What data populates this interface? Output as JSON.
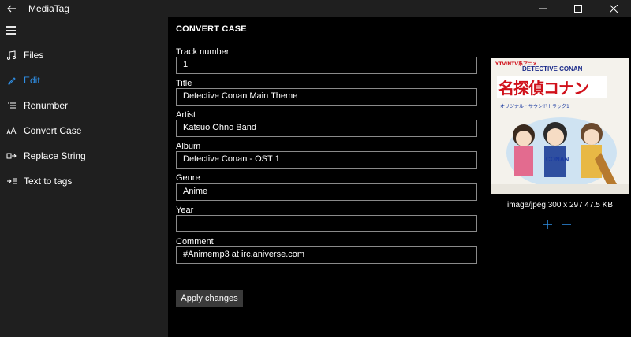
{
  "window": {
    "title": "MediaTag",
    "back_icon": "back-arrow-icon",
    "minimize_icon": "minimize-icon",
    "maximize_icon": "maximize-icon",
    "close_icon": "close-icon"
  },
  "sidebar": {
    "menu_icon": "hamburger-menu-icon",
    "items": [
      {
        "label": "Files",
        "icon": "music-note-icon",
        "active": false
      },
      {
        "label": "Edit",
        "icon": "pencil-icon",
        "active": true
      },
      {
        "label": "Renumber",
        "icon": "numbered-list-icon",
        "active": false
      },
      {
        "label": "Convert Case",
        "icon": "font-case-icon",
        "active": false
      },
      {
        "label": "Replace String",
        "icon": "replace-icon",
        "active": false
      },
      {
        "label": "Text to tags",
        "icon": "text-to-tags-icon",
        "active": false
      }
    ],
    "accent_color": "#2f8fe6"
  },
  "main": {
    "title": "CONVERT CASE",
    "fields": [
      {
        "label": "Track number",
        "value": "1"
      },
      {
        "label": "Title",
        "value": "Detective Conan Main Theme"
      },
      {
        "label": "Artist",
        "value": "Katsuo Ohno Band"
      },
      {
        "label": "Album",
        "value": "Detective Conan - OST 1"
      },
      {
        "label": "Genre",
        "value": "Anime"
      },
      {
        "label": "Year",
        "value": ""
      },
      {
        "label": "Comment",
        "value": "#Animemp3 at irc.aniverse.com"
      }
    ],
    "apply_label": "Apply changes"
  },
  "cover": {
    "info": "image/jpeg 300 x 297 47.5 KB",
    "add_icon": "plus-icon",
    "remove_icon": "minus-icon",
    "art_text": {
      "top": "YTV/NTV系アニメ",
      "subtitle": "DETECTIVE CONAN",
      "title": "名探偵コナン",
      "soundtrack": "オリジナル・サウンドトラック1",
      "logo": "CONAN"
    }
  }
}
